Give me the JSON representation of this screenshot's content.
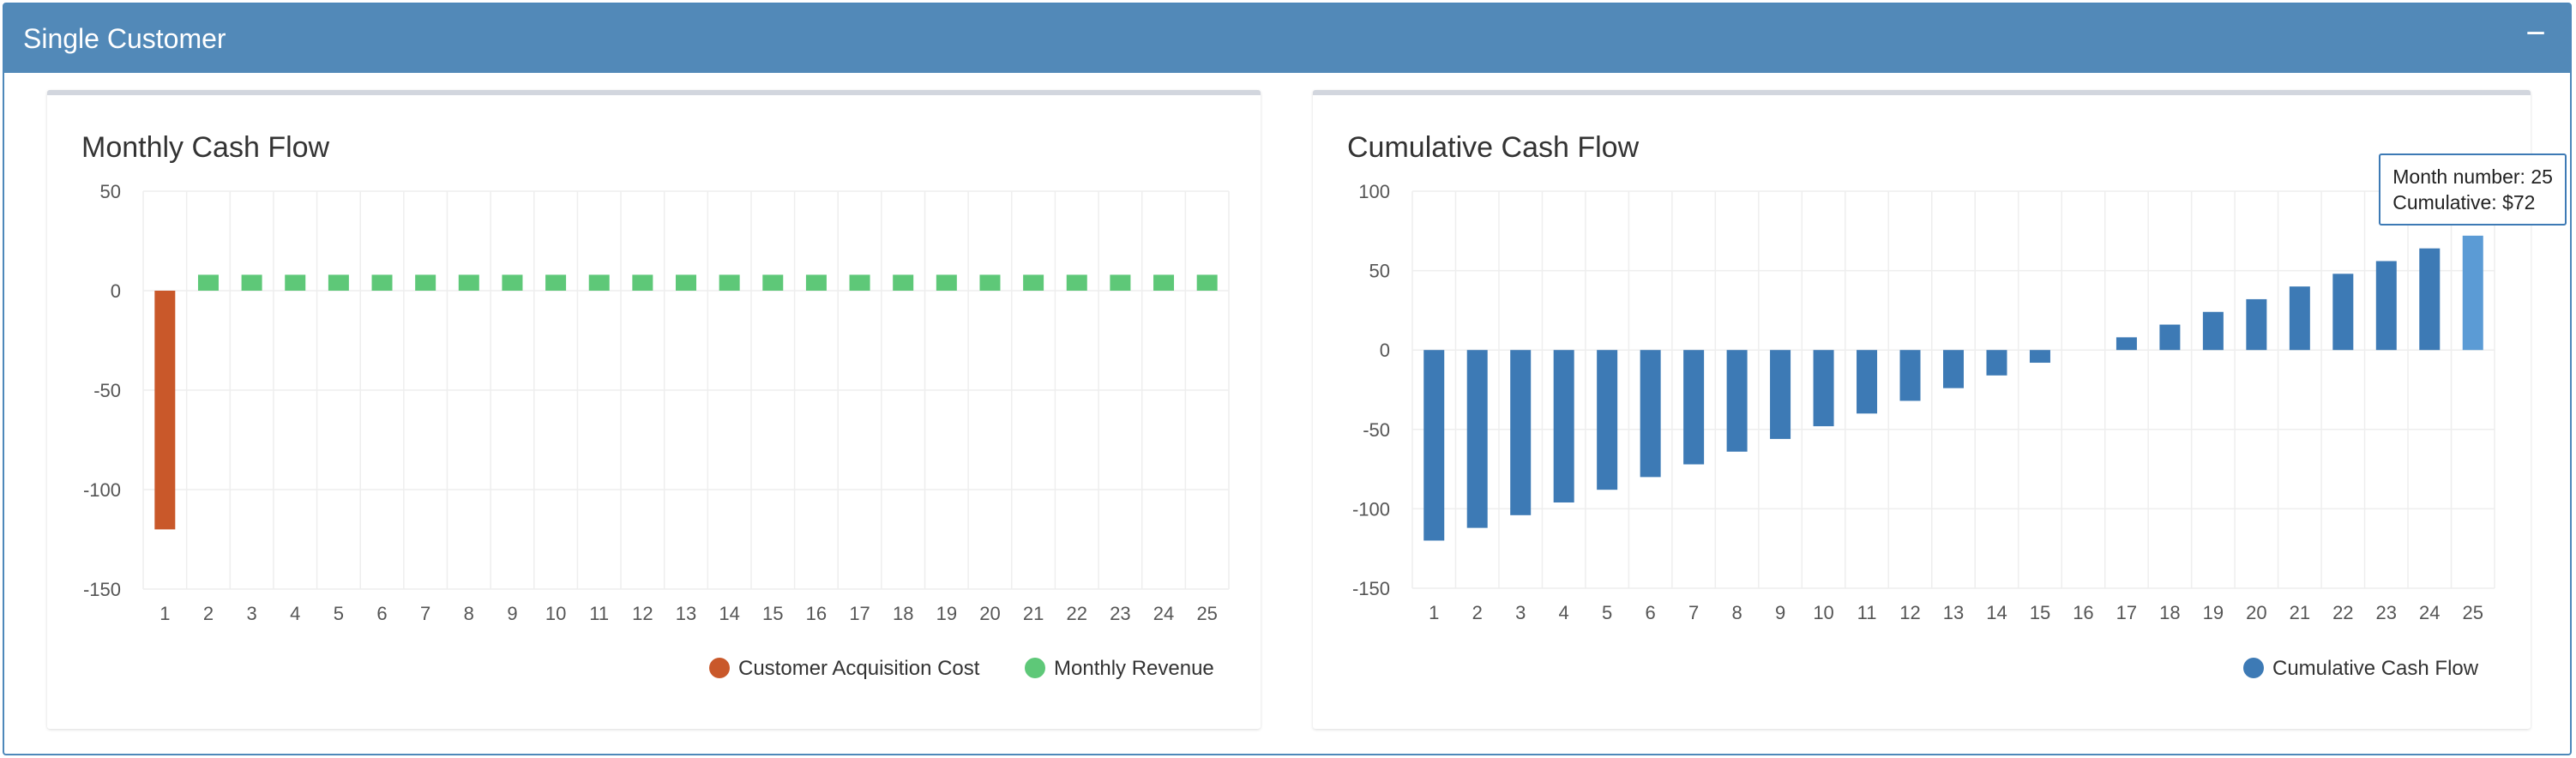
{
  "panel": {
    "title": "Single Customer",
    "collapse_label": "−"
  },
  "colors": {
    "cac": "#c9582a",
    "revenue": "#5ec878",
    "cumulative": "#3d7ab5",
    "cumulative_hover": "#5b9bd5"
  },
  "chart_data": [
    {
      "type": "bar",
      "title": "Monthly Cash Flow",
      "categories": [
        "1",
        "2",
        "3",
        "4",
        "5",
        "6",
        "7",
        "8",
        "9",
        "10",
        "11",
        "12",
        "13",
        "14",
        "15",
        "16",
        "17",
        "18",
        "19",
        "20",
        "21",
        "22",
        "23",
        "24",
        "25"
      ],
      "series": [
        {
          "name": "Customer Acquisition Cost",
          "values": [
            -120,
            null,
            null,
            null,
            null,
            null,
            null,
            null,
            null,
            null,
            null,
            null,
            null,
            null,
            null,
            null,
            null,
            null,
            null,
            null,
            null,
            null,
            null,
            null,
            null
          ]
        },
        {
          "name": "Monthly Revenue",
          "values": [
            null,
            8,
            8,
            8,
            8,
            8,
            8,
            8,
            8,
            8,
            8,
            8,
            8,
            8,
            8,
            8,
            8,
            8,
            8,
            8,
            8,
            8,
            8,
            8,
            8
          ]
        }
      ],
      "ylim": [
        -150,
        50
      ],
      "yticks": [
        -150,
        -100,
        -50,
        0,
        50
      ],
      "grid": true,
      "legend": "bottom-right"
    },
    {
      "type": "bar",
      "title": "Cumulative Cash Flow",
      "categories": [
        "1",
        "2",
        "3",
        "4",
        "5",
        "6",
        "7",
        "8",
        "9",
        "10",
        "11",
        "12",
        "13",
        "14",
        "15",
        "16",
        "17",
        "18",
        "19",
        "20",
        "21",
        "22",
        "23",
        "24",
        "25"
      ],
      "series": [
        {
          "name": "Cumulative Cash Flow",
          "values": [
            -120,
            -112,
            -104,
            -96,
            -88,
            -80,
            -72,
            -64,
            -56,
            -48,
            -40,
            -32,
            -24,
            -16,
            -8,
            0,
            8,
            16,
            24,
            32,
            40,
            48,
            56,
            64,
            72
          ]
        }
      ],
      "ylim": [
        -150,
        100
      ],
      "yticks": [
        -150,
        -100,
        -50,
        0,
        50,
        100
      ],
      "grid": true,
      "legend": "bottom-right",
      "tooltip": {
        "line1": "Month number: 25",
        "line2": "Cumulative: $72",
        "index": 24
      }
    }
  ]
}
